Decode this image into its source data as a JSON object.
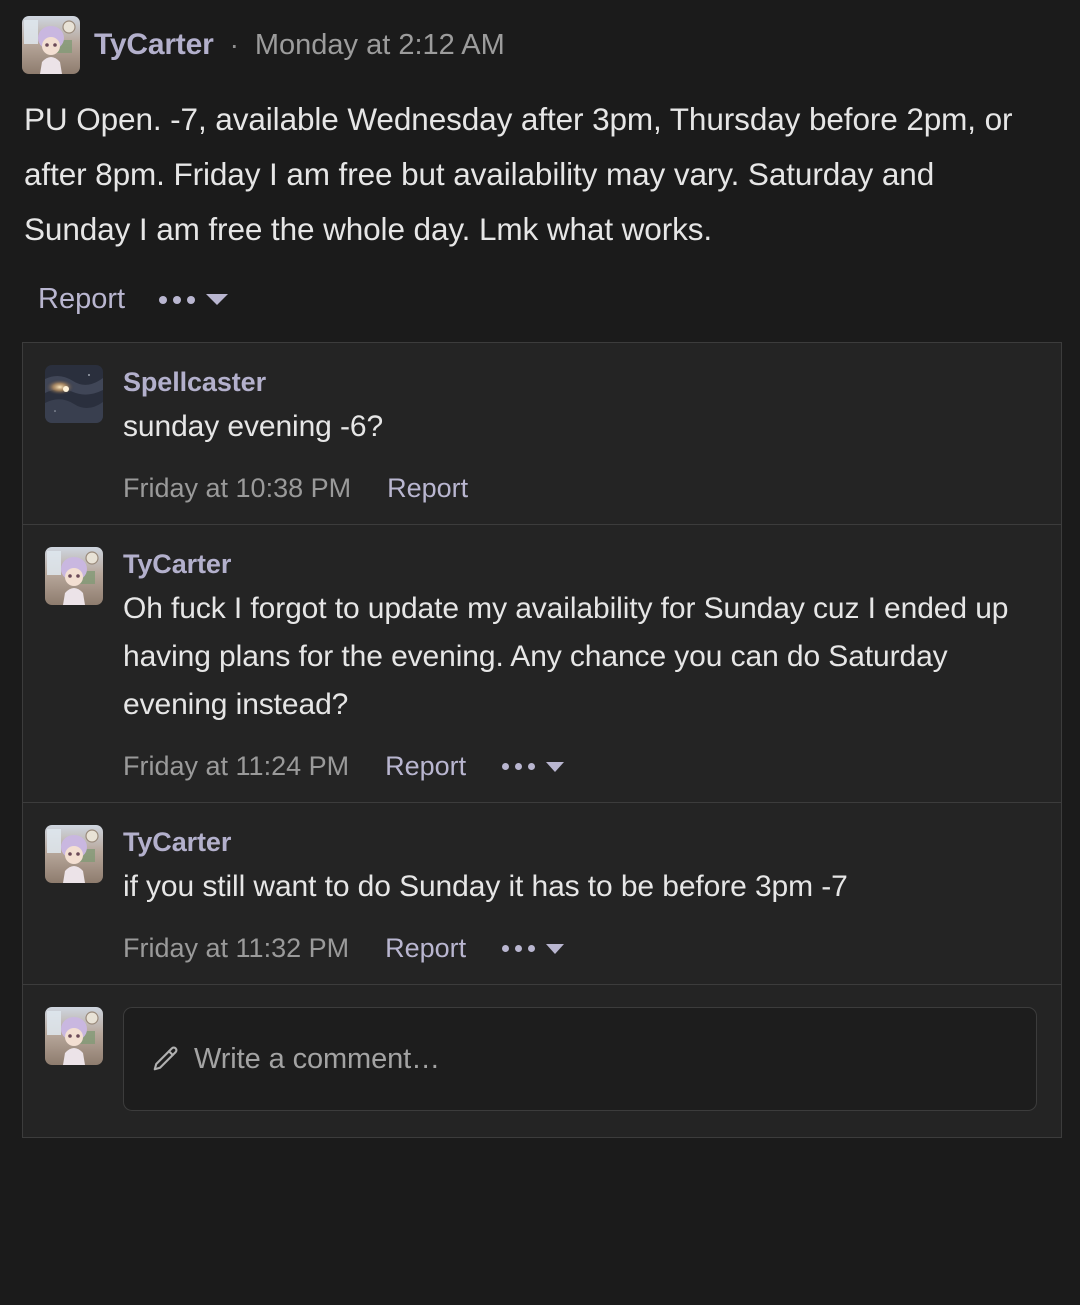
{
  "post": {
    "author": "TyCarter",
    "separator": "·",
    "timestamp": "Monday at 2:12 AM",
    "body": "PU Open. -7, available Wednesday after 3pm, Thursday before 2pm, or after 8pm. Friday I am free but availability may vary. Saturday and Sunday I am free the whole day. Lmk what works.",
    "report_label": "Report"
  },
  "replies": [
    {
      "author": "Spellcaster",
      "text": "sunday evening -6?",
      "timestamp": "Friday at 10:38 PM",
      "report_label": "Report",
      "has_menu": false,
      "avatar": "nebula"
    },
    {
      "author": "TyCarter",
      "text": "Oh fuck I forgot to update my availability for Sunday cuz I ended up having plans for the evening. Any chance you can do Saturday evening instead?",
      "timestamp": "Friday at 11:24 PM",
      "report_label": "Report",
      "has_menu": true,
      "avatar": "anime"
    },
    {
      "author": "TyCarter",
      "text": "if you still want to do Sunday it has to be before 3pm -7",
      "timestamp": "Friday at 11:32 PM",
      "report_label": "Report",
      "has_menu": true,
      "avatar": "anime"
    }
  ],
  "composer": {
    "placeholder": "Write a comment…",
    "icon": "pencil-icon",
    "avatar": "anime"
  },
  "icons": {
    "overflow": "ellipsis-icon",
    "caret": "chevron-down-icon"
  },
  "colors": {
    "page_background": "#1b1b1b",
    "panel_background": "#242424",
    "border": "#3c3c3c",
    "username": "#b3b0cc",
    "link": "#b9b6d0",
    "body_text": "#e6e6e6",
    "muted_text": "#9a9a9a"
  }
}
